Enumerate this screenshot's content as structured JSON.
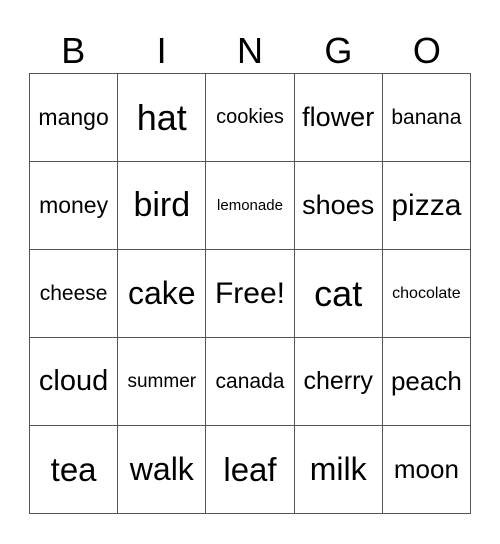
{
  "header": {
    "letters": [
      "B",
      "I",
      "N",
      "G",
      "O"
    ]
  },
  "grid": {
    "rows": [
      [
        "mango",
        "hat",
        "cookies",
        "flower",
        "banana"
      ],
      [
        "money",
        "bird",
        "lemonade",
        "shoes",
        "pizza"
      ],
      [
        "cheese",
        "cake",
        "Free!",
        "cat",
        "chocolate"
      ],
      [
        "cloud",
        "summer",
        "canada",
        "cherry",
        "peach"
      ],
      [
        "tea",
        "walk",
        "leaf",
        "milk",
        "moon"
      ]
    ]
  }
}
